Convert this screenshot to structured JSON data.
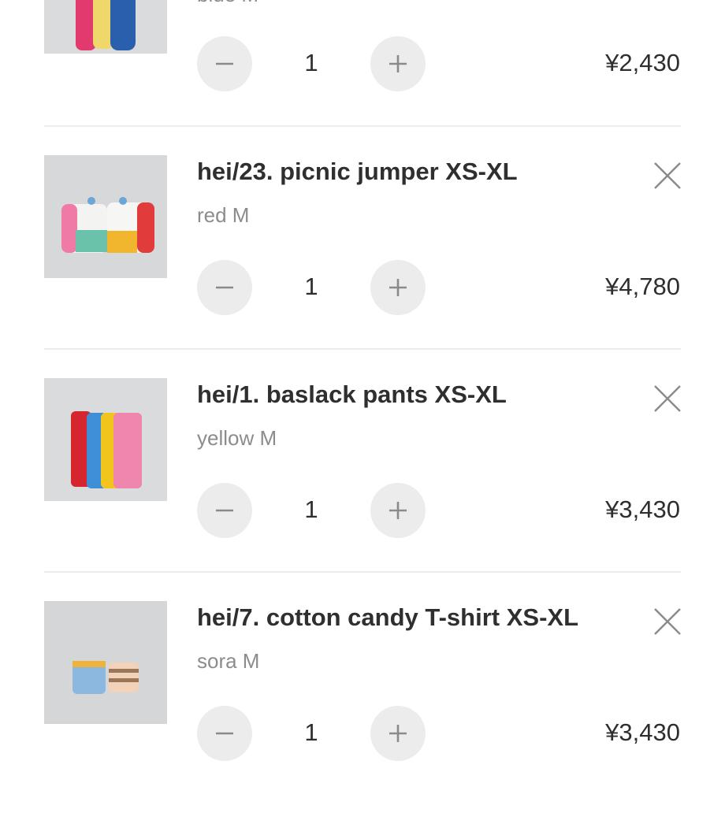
{
  "currency_note": "",
  "items": [
    {
      "title": "",
      "variant": "blue M",
      "quantity": "1",
      "price": "¥2,430"
    },
    {
      "title": "hei/23. picnic jumper XS-XL",
      "variant": "red M",
      "quantity": "1",
      "price": "¥4,780"
    },
    {
      "title": "hei/1. baslack pants XS-XL",
      "variant": "yellow M",
      "quantity": "1",
      "price": "¥3,430"
    },
    {
      "title": "hei/7. cotton candy T-shirt XS-XL",
      "variant": "sora M",
      "quantity": "1",
      "price": "¥3,430"
    }
  ],
  "icons": {
    "minus": "minus-icon",
    "plus": "plus-icon",
    "remove": "close-icon"
  },
  "colors": {
    "text": "#2e2e2e",
    "muted": "#8c8c8c",
    "button_bg": "#ececec",
    "icon": "#8a8a8a",
    "divider": "#ececec"
  }
}
